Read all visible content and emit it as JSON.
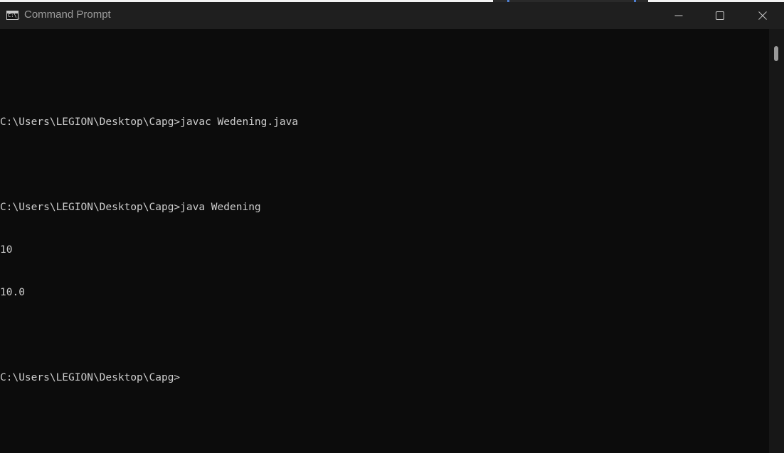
{
  "window": {
    "title": "Command Prompt",
    "app_icon": "cmd-icon",
    "app_icon_text": "C:\\_",
    "controls": {
      "minimize": "minimize-icon",
      "maximize": "maximize-icon",
      "close": "close-icon"
    }
  },
  "console": {
    "lines": [
      "",
      "C:\\Users\\LEGION\\Desktop\\Capg>javac Wedening.java",
      "",
      "C:\\Users\\LEGION\\Desktop\\Capg>java Wedening",
      "10",
      "10.0",
      "",
      "C:\\Users\\LEGION\\Desktop\\Capg>"
    ]
  },
  "colors": {
    "background": "#0c0c0c",
    "text": "#cccccc",
    "titlebar": "#1f1f1f"
  }
}
